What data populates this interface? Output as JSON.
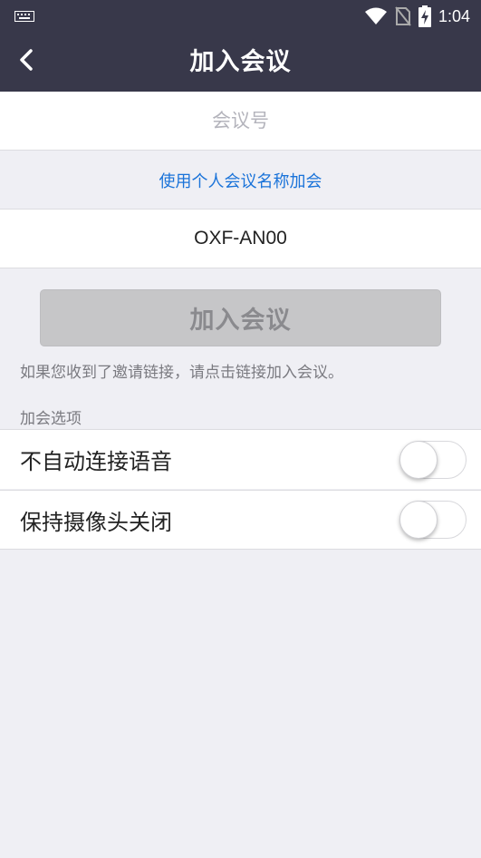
{
  "status_bar": {
    "time": "1:04",
    "icons": [
      "keyboard-icon",
      "wifi-icon",
      "no-sim-icon",
      "battery-charging-icon"
    ]
  },
  "header": {
    "title": "加入会议",
    "back_icon": "chevron-left-icon"
  },
  "form": {
    "meeting_id_placeholder": "会议号",
    "meeting_id_value": "",
    "use_personal_link": "使用个人会议名称加会",
    "display_name_value": "OXF-AN00",
    "join_button": "加入会议",
    "join_enabled": false
  },
  "hint": "如果您收到了邀请链接，请点击链接加入会议。",
  "options": {
    "section_label": "加会选项",
    "items": [
      {
        "label": "不自动连接语音",
        "enabled": false
      },
      {
        "label": "保持摄像头关闭",
        "enabled": false
      }
    ]
  },
  "colors": {
    "header_bg": "#38384a",
    "link": "#1a73d9",
    "page_bg": "#efeff4",
    "disabled_button": "#c6c6c8"
  }
}
